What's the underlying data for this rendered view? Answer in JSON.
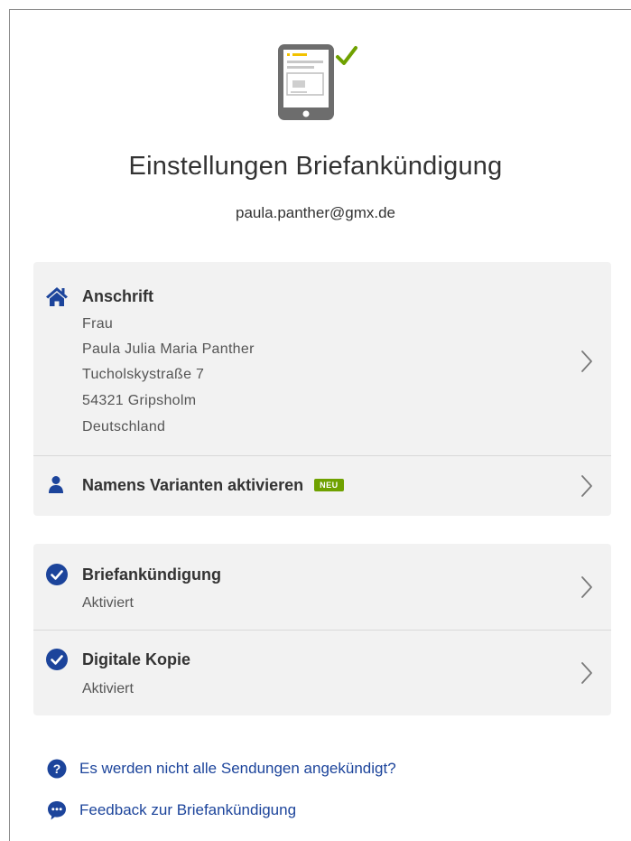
{
  "header": {
    "title": "Einstellungen Briefankündigung",
    "email": "paula.panther@gmx.de"
  },
  "address_card": {
    "address": {
      "label": "Anschrift",
      "lines": [
        "Frau",
        "Paula Julia Maria Panther",
        "Tucholskystraße 7",
        "54321 Gripsholm",
        "Deutschland"
      ]
    },
    "name_variants": {
      "label": "Namens Varianten aktivieren",
      "badge": "NEU"
    }
  },
  "settings_card": {
    "items": [
      {
        "label": "Briefankündigung",
        "status": "Aktiviert"
      },
      {
        "label": "Digitale Kopie",
        "status": "Aktiviert"
      }
    ]
  },
  "links": [
    {
      "label": "Es werden nicht alle Sendungen angekündigt?",
      "icon": "question-circle-icon"
    },
    {
      "label": "Feedback zur Briefankündigung",
      "icon": "speech-bubble-icon"
    }
  ],
  "colors": {
    "brand_blue": "#1c449b",
    "badge_green": "#6fa100",
    "check_green": "#6fa100",
    "card_bg": "#f2f2f2"
  }
}
